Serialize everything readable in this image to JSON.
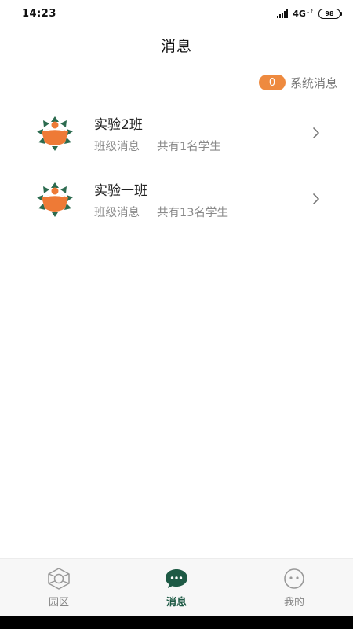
{
  "status_bar": {
    "time": "14:23",
    "network": "4G",
    "battery": "98"
  },
  "header": {
    "title": "消息"
  },
  "system_message": {
    "count": "0",
    "label": "系统消息"
  },
  "classes": [
    {
      "name": "实验2班",
      "type": "班级消息",
      "students": "共有1名学生"
    },
    {
      "name": "实验一班",
      "type": "班级消息",
      "students": "共有13名学生"
    }
  ],
  "tabs": [
    {
      "label": "园区",
      "icon": "campus-icon",
      "active": false
    },
    {
      "label": "消息",
      "icon": "chat-icon",
      "active": true
    },
    {
      "label": "我的",
      "icon": "profile-face-icon",
      "active": false
    }
  ],
  "colors": {
    "accent_orange": "#ee8a3f",
    "brand_green": "#1e5a45",
    "muted_text": "#8a8a8a"
  }
}
